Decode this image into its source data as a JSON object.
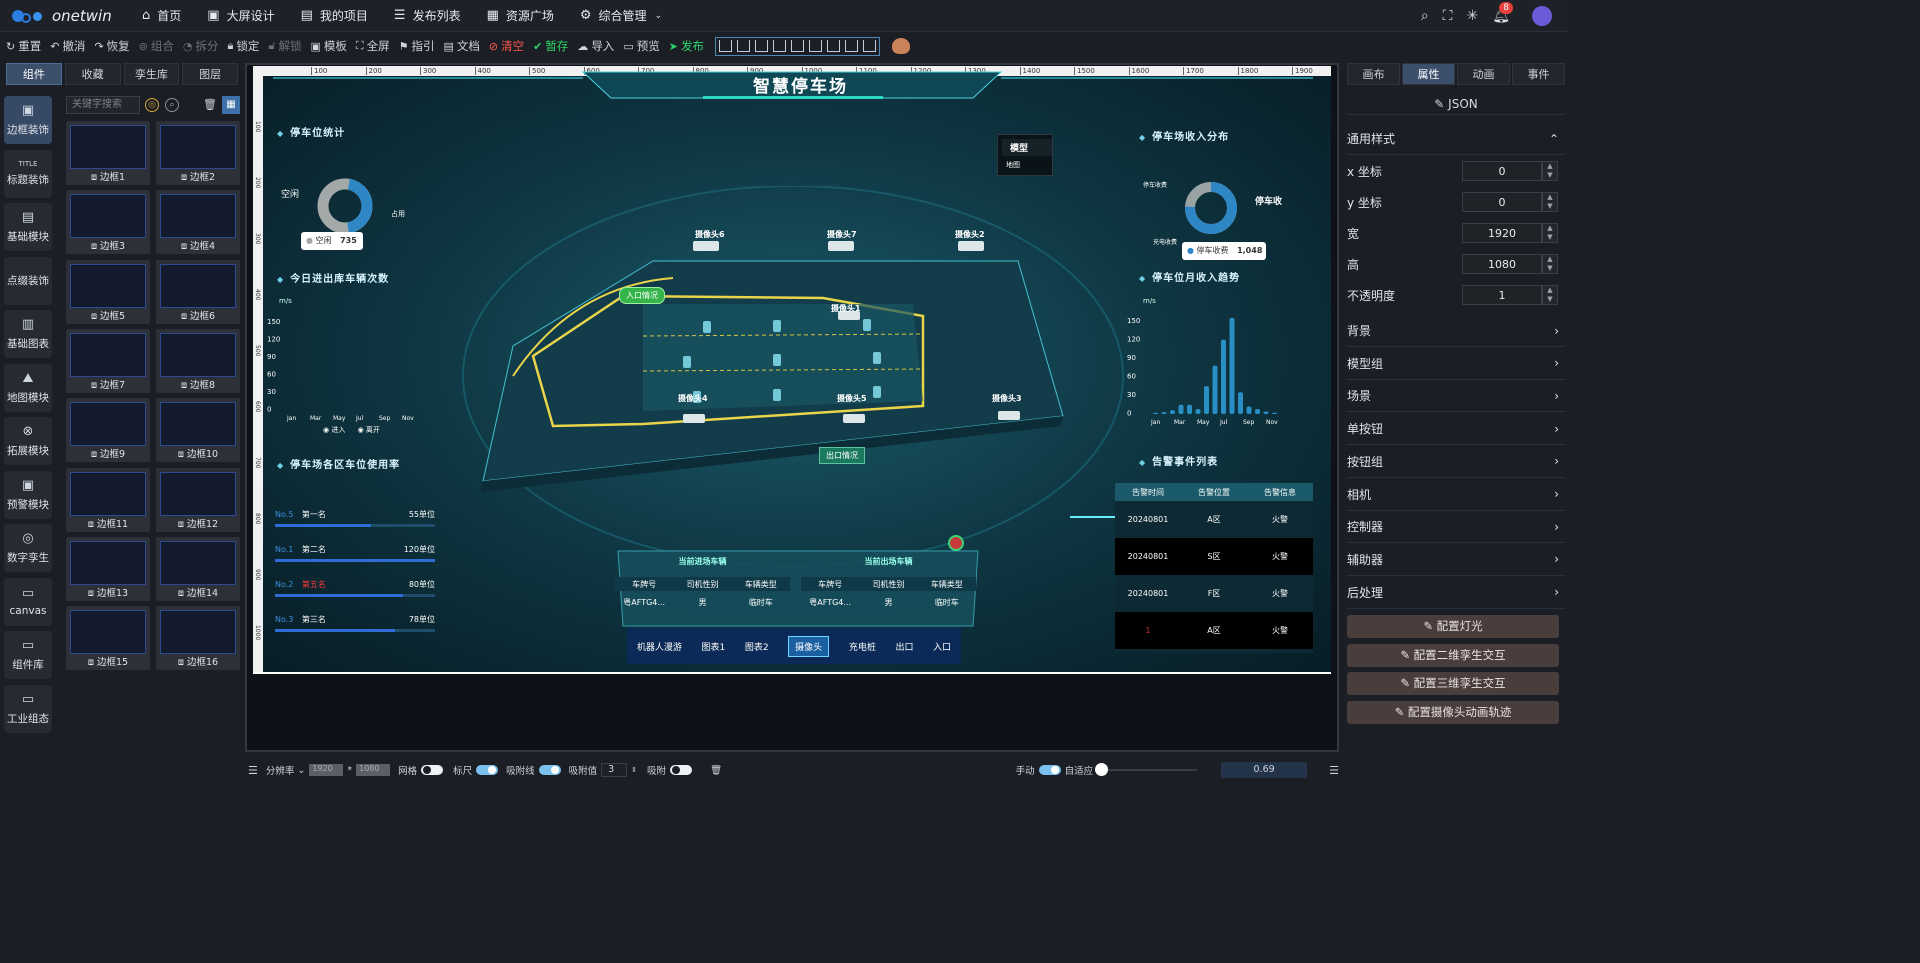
{
  "app": {
    "brand": "onetwin"
  },
  "nav": [
    {
      "icon": "home-icon",
      "glyph": "⌂",
      "label": "首页"
    },
    {
      "icon": "screen-icon",
      "glyph": "▣",
      "label": "大屏设计"
    },
    {
      "icon": "project-icon",
      "glyph": "▤",
      "label": "我的项目"
    },
    {
      "icon": "publish-icon",
      "glyph": "☰",
      "label": "发布列表"
    },
    {
      "icon": "resource-icon",
      "glyph": "▦",
      "label": "资源广场"
    },
    {
      "icon": "settings-icon",
      "glyph": "⚙",
      "label": "综合管理"
    }
  ],
  "notifications": {
    "count": "8"
  },
  "toolbar": {
    "reset": "重置",
    "undo": "撤消",
    "redo": "恢复",
    "group": "组合",
    "split": "拆分",
    "lock": "锁定",
    "unlock": "解锁",
    "template": "模板",
    "fullscreen": "全屏",
    "guide": "指引",
    "doc": "文档",
    "clear": "清空",
    "save": "暂存",
    "import": "导入",
    "preview": "预览",
    "publish": "发布"
  },
  "left_tabs": [
    "组件",
    "收藏",
    "孪生库",
    "图层"
  ],
  "categories": [
    "边框装饰",
    "标题装饰",
    "基础模块",
    "点缀装饰",
    "基础图表",
    "地图模块",
    "拓展模块",
    "预警模块",
    "数字孪生",
    "canvas",
    "组件库",
    "工业组态"
  ],
  "search": {
    "placeholder": "关键字搜索"
  },
  "thumbnails": [
    "边框1",
    "边框2",
    "边框3",
    "边框4",
    "边框5",
    "边框6",
    "边框7",
    "边框8",
    "边框9",
    "边框10",
    "边框11",
    "边框12",
    "边框13",
    "边框14",
    "边框15",
    "边框16"
  ],
  "stage": {
    "title": "智慧停车场",
    "ruler_ticks": [
      "100",
      "200",
      "300",
      "400",
      "500",
      "600",
      "700",
      "800",
      "900",
      "1000",
      "1100",
      "1200",
      "1300",
      "1400",
      "1500",
      "1600",
      "1700",
      "1800",
      "1900"
    ],
    "ruler_left_ticks": [
      "100",
      "200",
      "300",
      "400",
      "500",
      "600",
      "700",
      "800",
      "900",
      "1000"
    ],
    "panel_parking_stats": "停车位统计",
    "donut_left": {
      "free_label": "空闲",
      "occupied_label": "占用",
      "tooltip_label": "空闲",
      "tooltip_value": "735"
    },
    "panel_today_in": "今日进出库车辆次数",
    "line_chart": {
      "unit": "m/s",
      "yticks": [
        "150",
        "120",
        "90",
        "60",
        "30",
        "0"
      ],
      "xticks": [
        "Jan",
        "Mar",
        "May",
        "Jul",
        "Sep",
        "Nov"
      ],
      "legend": [
        "进入",
        "离开"
      ]
    },
    "panel_usage": "停车场各区车位使用率",
    "usage_rows": [
      {
        "no": "No.5",
        "name": "第一名",
        "value": "55单位",
        "pct": 0.6
      },
      {
        "no": "No.1",
        "name": "第二名",
        "value": "120单位",
        "pct": 1.0
      },
      {
        "no": "No.2",
        "name": "第五名",
        "value": "80单位",
        "pct": 0.8
      },
      {
        "no": "No.3",
        "name": "第三名",
        "value": "78单位",
        "pct": 0.75
      }
    ],
    "model_box": {
      "title": "模型",
      "item": "地图"
    },
    "cameras": [
      "摄像头6",
      "摄像头7",
      "摄像头2",
      "摄像头1",
      "摄像头4",
      "摄像头5",
      "摄像头3"
    ],
    "entry_tag": "入口情况",
    "exit_tag": "出口情况",
    "panel_income": "停车场收入分布",
    "donut_right": {
      "label_a": "停车收费",
      "label_b": "充电收费",
      "label_main": "停车收",
      "tooltip_label": "停车收费",
      "tooltip_value": "1,048"
    },
    "panel_month": "停车位月收入趋势",
    "bar_chart": {
      "unit": "m/s",
      "yticks": [
        "150",
        "120",
        "90",
        "60",
        "30",
        "0"
      ],
      "xticks": [
        "Jan",
        "Mar",
        "May",
        "Jul",
        "Sep",
        "Nov"
      ]
    },
    "panel_alarm": "告警事件列表",
    "alarm_headers": [
      "告警时间",
      "告警位置",
      "告警信息"
    ],
    "alarm_rows": [
      [
        "20240801",
        "A区",
        "火警"
      ],
      [
        "20240801",
        "S区",
        "火警"
      ],
      [
        "20240801",
        "F区",
        "火警"
      ],
      [
        "1",
        "A区",
        "火警"
      ]
    ],
    "in_table": {
      "title": "当前进场车辆",
      "headers": [
        "车牌号",
        "司机性别",
        "车辆类型"
      ],
      "row": [
        "粤AFTG4...",
        "男",
        "临时车"
      ]
    },
    "out_table": {
      "title": "当前出场车辆",
      "headers": [
        "车牌号",
        "司机性别",
        "车辆类型"
      ],
      "row": [
        "粤AFTG4...",
        "男",
        "临时车"
      ]
    },
    "bottom_tabs": [
      "机器人漫游",
      "图表1",
      "图表2",
      "摄像头",
      "充电桩",
      "出口",
      "入口"
    ]
  },
  "status": {
    "resolution": "分辨率",
    "width": "1920",
    "height": "1080",
    "grid": "网格",
    "ruler": "标尺",
    "snap_line": "吸附线",
    "snap_value_label": "吸附值",
    "snap_value": "3",
    "snap": "吸附",
    "manual": "手动",
    "adaptive": "自适应",
    "zoom": "0.69"
  },
  "right_tabs": [
    "画布",
    "属性",
    "动画",
    "事件"
  ],
  "props": {
    "json_label": "JSON",
    "general": "通用样式",
    "x_label": "x 坐标",
    "x": "0",
    "y_label": "y 坐标",
    "y": "0",
    "w_label": "宽",
    "w": "1920",
    "h_label": "高",
    "h": "1080",
    "op_label": "不透明度",
    "op": "1"
  },
  "sections": [
    "背景",
    "模型组",
    "场景",
    "单按钮",
    "按钮组",
    "相机",
    "控制器",
    "辅助器",
    "后处理"
  ],
  "config_buttons": [
    "配置灯光",
    "配置二维孪生交互",
    "配置三维孪生交互",
    "配置摄像头动画轨迹"
  ]
}
